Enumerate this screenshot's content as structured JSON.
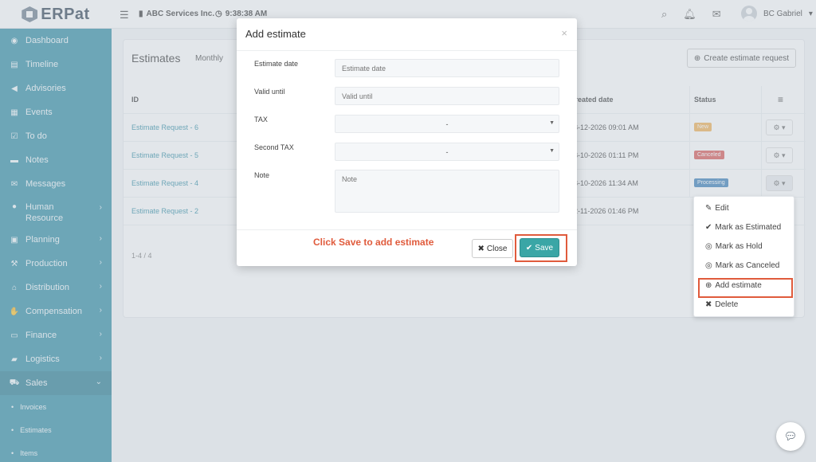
{
  "topbar": {
    "brand": "ERPat",
    "menu_icon": "list-icon",
    "company": "ABC Services Inc.",
    "time": "9:38:38 AM",
    "user_name": "BC Gabriel"
  },
  "sidebar": {
    "items": [
      {
        "label": "Dashboard",
        "icon": "dashboard-icon",
        "glyph": "◉"
      },
      {
        "label": "Timeline",
        "icon": "timeline-icon",
        "glyph": "▤"
      },
      {
        "label": "Advisories",
        "icon": "bullhorn-icon",
        "glyph": "📢"
      },
      {
        "label": "Events",
        "icon": "calendar-icon",
        "glyph": "▦"
      },
      {
        "label": "To do",
        "icon": "checkbox-icon",
        "glyph": "☑"
      },
      {
        "label": "Notes",
        "icon": "note-icon",
        "glyph": "▬"
      },
      {
        "label": "Messages",
        "icon": "envelope-icon",
        "glyph": "✉"
      },
      {
        "label": "Human Resource",
        "icon": "users-icon",
        "glyph": "👥"
      },
      {
        "label": "Planning",
        "icon": "briefcase-icon",
        "glyph": "▣"
      },
      {
        "label": "Production",
        "icon": "gavel-icon",
        "glyph": "⚒"
      },
      {
        "label": "Distribution",
        "icon": "bank-icon",
        "glyph": "🏛"
      },
      {
        "label": "Compensation",
        "icon": "handshake-icon",
        "glyph": "🤝"
      },
      {
        "label": "Finance",
        "icon": "money-icon",
        "glyph": "▭"
      },
      {
        "label": "Logistics",
        "icon": "truck-icon",
        "glyph": "🚚"
      },
      {
        "label": "Sales",
        "icon": "cart-icon",
        "glyph": "🛒"
      }
    ],
    "sub_items": [
      "Invoices",
      "Estimates",
      "Items"
    ]
  },
  "page": {
    "title": "Estimates",
    "tab": "Monthly",
    "create_button": "Create estimate request",
    "columns": {
      "id": "ID",
      "created": "Created date",
      "status": "Status"
    },
    "rows": [
      {
        "id": "Estimate Request - 6",
        "created": "08-12-2026 09:01 AM",
        "status": "New"
      },
      {
        "id": "Estimate Request - 5",
        "created": "08-10-2026 01:11 PM",
        "status": "Canceled"
      },
      {
        "id": "Estimate Request - 4",
        "created": "08-10-2026 11:34 AM",
        "status": "Processing"
      },
      {
        "id": "Estimate Request - 2",
        "created": "02-11-2026 01:46 PM",
        "status": ""
      }
    ],
    "pager": "1-4 / 4"
  },
  "action_menu": {
    "items": [
      "Edit",
      "Mark as Estimated",
      "Mark as Hold",
      "Mark as Canceled",
      "Add estimate",
      "Delete"
    ]
  },
  "modal": {
    "title": "Add estimate",
    "fields": {
      "estimate_date_label": "Estimate date",
      "estimate_date_placeholder": "Estimate date",
      "valid_until_label": "Valid until",
      "valid_until_placeholder": "Valid until",
      "tax_label": "TAX",
      "tax_value": "-",
      "second_tax_label": "Second TAX",
      "second_tax_value": "-",
      "note_label": "Note",
      "note_placeholder": "Note"
    },
    "hint": "Click Save to add estimate",
    "close_button": "Close",
    "save_button": "Save"
  },
  "colors": {
    "sidebar": "#2a8aa3",
    "save": "#3aa6a6",
    "highlight": "#e05b3c"
  }
}
